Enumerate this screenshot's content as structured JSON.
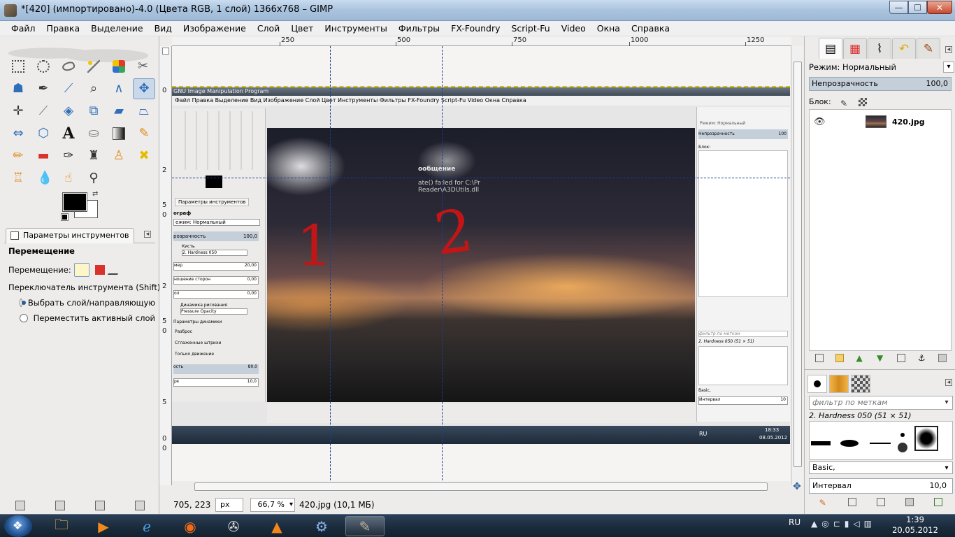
{
  "window": {
    "title": "*[420] (импортировано)-4.0 (Цвета RGB, 1 слой) 1366x768 – GIMP",
    "min_label": "—",
    "max_label": "☐",
    "close_label": "✕"
  },
  "menu": [
    "Файл",
    "Правка",
    "Выделение",
    "Вид",
    "Изображение",
    "Слой",
    "Цвет",
    "Инструменты",
    "Фильтры",
    "FX-Foundry",
    "Script-Fu",
    "Video",
    "Окна",
    "Справка"
  ],
  "toolbox": {
    "tab_label": "Параметры инструментов",
    "tool_name": "Перемещение",
    "move_label": "Перемещение:",
    "switch_label": "Переключатель инструмента  (Shift)",
    "radio_pick": "Выбрать слой/направляющую",
    "radio_active": "Переместить активный слой"
  },
  "rulers": {
    "h_labels": [
      "250",
      "500",
      "750",
      "1000",
      "1250"
    ],
    "v_labels": [
      "0",
      "2",
      "5",
      "0",
      "2",
      "5",
      "0",
      "5",
      "0",
      "0"
    ]
  },
  "inner": {
    "title": "GNU Image Manipulation Program",
    "menu": "Файл  Правка  Выделение  Вид  Изображение  Слой  Цвет  Инструменты  Фильтры  FX-Foundry  Script-Fu  Video  Окна  Справка",
    "dialog_title": "ообщение",
    "dialog_line1": "ate() failed for C:\\Pr",
    "dialog_line2": "Reader\\A3DUtils.dll",
    "tool_tab": "Параметры инструментов",
    "tool_name": "ограф",
    "mode": "ежим: Нормальный",
    "opacity": "розрачность",
    "opacity_val": "100,0",
    "brush_label": "Кисть",
    "brush_val": "2. Hardness 050",
    "size": "мер",
    "size_val": "20,00",
    "aspect": "ношение сторон",
    "aspect_val": "0,00",
    "angle": "ол",
    "angle_val": "0,00",
    "dynamics": "Динамика рисования",
    "dynamics_val": "Pressure Opacity",
    "dyn_params": "Параметры динамики",
    "scatter": "Разброс",
    "smooth": "Сглаженные штрихи",
    "only_move": "Только движение",
    "hardness": "ость",
    "hardness_val": "80,0",
    "rate": "рк",
    "rate_val": "10,0",
    "r_mode": "Режим: Нормальный",
    "r_opacity": "Непрозрачность",
    "r_opacity_val": "100",
    "r_lock": "Блок:",
    "r_filter": "фильтр по меткам",
    "r_brush": "2. Hardness 050 (51 × 51)",
    "r_basic": "Basic,",
    "r_interval": "Интервал",
    "r_interval_val": "10",
    "lang": "RU",
    "time": "18:33",
    "date": "08.05.2012"
  },
  "marks": {
    "one": "1",
    "two": "2"
  },
  "status": {
    "coords": "705, 223",
    "unit": "px",
    "zoom": "66,7 %",
    "file": "420.jpg (10,1 МБ)"
  },
  "dock": {
    "mode": "Режим: Нормальный",
    "opacity_label": "Непрозрачность",
    "opacity_value": "100,0",
    "lock_label": "Блок:",
    "layer_name": "420.jpg",
    "filter_placeholder": "фильтр по меткам",
    "brush_name": "2. Hardness 050 (51 × 51)",
    "brush_set": "Basic,",
    "interval_label": "Интервал",
    "interval_value": "10,0"
  },
  "taskbar": {
    "lang": "RU",
    "time": "1:39",
    "date": "20.05.2012"
  }
}
